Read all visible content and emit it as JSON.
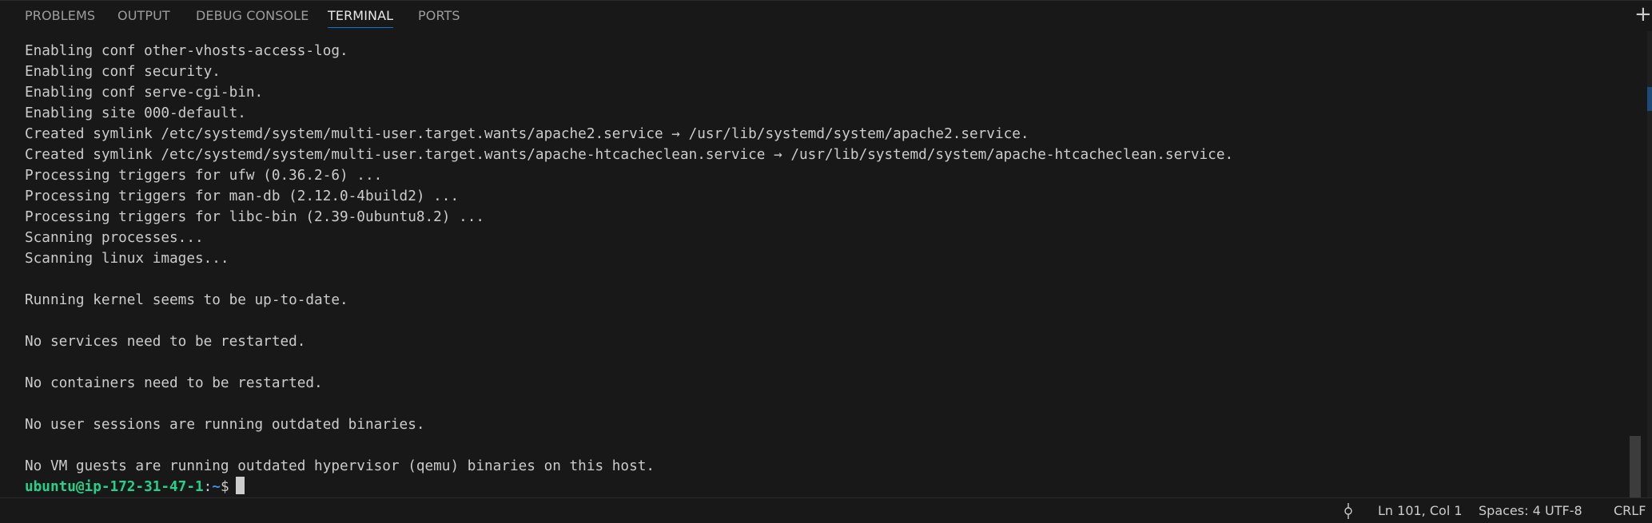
{
  "tabs": [
    {
      "label": "PROBLEMS",
      "active": false
    },
    {
      "label": "OUTPUT",
      "active": false
    },
    {
      "label": "DEBUG CONSOLE",
      "active": false
    },
    {
      "label": "TERMINAL",
      "active": true
    },
    {
      "label": "PORTS",
      "active": false
    }
  ],
  "terminal": {
    "lines": [
      "Enabling conf other-vhosts-access-log.",
      "Enabling conf security.",
      "Enabling conf serve-cgi-bin.",
      "Enabling site 000-default.",
      "Created symlink /etc/systemd/system/multi-user.target.wants/apache2.service → /usr/lib/systemd/system/apache2.service.",
      "Created symlink /etc/systemd/system/multi-user.target.wants/apache-htcacheclean.service → /usr/lib/systemd/system/apache-htcacheclean.service.",
      "Processing triggers for ufw (0.36.2-6) ...",
      "Processing triggers for man-db (2.12.0-4build2) ...",
      "Processing triggers for libc-bin (2.39-0ubuntu8.2) ...",
      "Scanning processes...",
      "Scanning linux images...",
      "",
      "Running kernel seems to be up-to-date.",
      "",
      "No services need to be restarted.",
      "",
      "No containers need to be restarted.",
      "",
      "No user sessions are running outdated binaries.",
      "",
      "No VM guests are running outdated hypervisor (qemu) binaries on this host."
    ],
    "prompt": {
      "user_host": "ubuntu@ip-172-31-47-1",
      "separator": ":",
      "path": "~",
      "symbol": "$"
    }
  },
  "statusbar": {
    "position": "Ln 101, Col 1",
    "indent": "Spaces: 4",
    "encoding": "UTF-8",
    "eol": "CRLF"
  },
  "icons": {
    "new_terminal": "plus-icon",
    "commit": "git-commit-icon"
  },
  "colors": {
    "accent": "#0078d4",
    "prompt_user": "#23d18b",
    "prompt_path": "#3b8eea",
    "background": "#181818",
    "text": "#cccccc"
  }
}
